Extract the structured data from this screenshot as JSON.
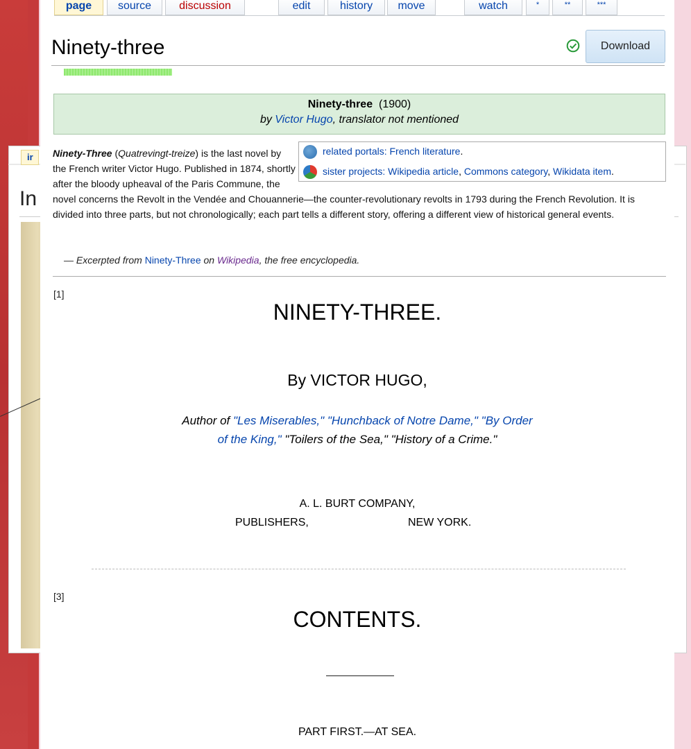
{
  "tabs": [
    {
      "label": "page",
      "active": true
    },
    {
      "label": "source"
    },
    {
      "label": "discussion",
      "red": true
    },
    {
      "label": "edit"
    },
    {
      "label": "history"
    },
    {
      "label": "move"
    },
    {
      "label": "watch"
    },
    {
      "label": "*"
    },
    {
      "label": "**"
    },
    {
      "label": "***"
    }
  ],
  "background_window": {
    "tab_label": "ir",
    "title": "In"
  },
  "page_title": "Ninety-three",
  "download_label": "Download",
  "header": {
    "title": "Ninety-three",
    "year": "(1900)",
    "by": "by",
    "author": "Victor Hugo",
    "translator": ", translator not mentioned"
  },
  "sidebox": {
    "portals_label": "related portals:",
    "portals_link": "French literature",
    "portals_end": ".",
    "sister_label": "sister projects:",
    "sister_links": [
      "Wikipedia article",
      "Commons category",
      "Wikidata item"
    ],
    "sister_end": "."
  },
  "intro": {
    "bold_title": "Ninety-Three",
    "original_title": "Quatrevingt-treize",
    "text": " is the last novel by the French writer Victor Hugo. Published in 1874, shortly after the bloody upheaval of the Paris Commune, the novel concerns the Revolt in the Vendée and Chouannerie—the counter-revolutionary revolts in 1793 during the French Revolution. It is divided into three parts, but not chronologically; each part tells a different story, offering a different view of historical general events."
  },
  "excerpt": {
    "prefix": "— Excerpted from ",
    "link": "Ninety-Three",
    "on": " on ",
    "wikipedia": "Wikipedia",
    "suffix": ", the free encyclopedia."
  },
  "book": {
    "page_ref_1": "[1]",
    "title": "NINETY-THREE.",
    "byline": "By VICTOR HUGO,",
    "author_of": "Author of ",
    "works_line1": "\"Les Miserables,\" \"Hunchback of Notre Dame,\" \"By Order",
    "works_line2_link": "of the King,\"",
    "works_line2_rest": " \"Toilers of the Sea,\" \"History of a Crime.\"",
    "publisher": "A. L. BURT COMPANY,",
    "publishers": "PUBLISHERS,",
    "city": "NEW YORK.",
    "page_ref_3": "[3]",
    "contents": "CONTENTS.",
    "part_first": "PART FIRST.—AT SEA."
  }
}
